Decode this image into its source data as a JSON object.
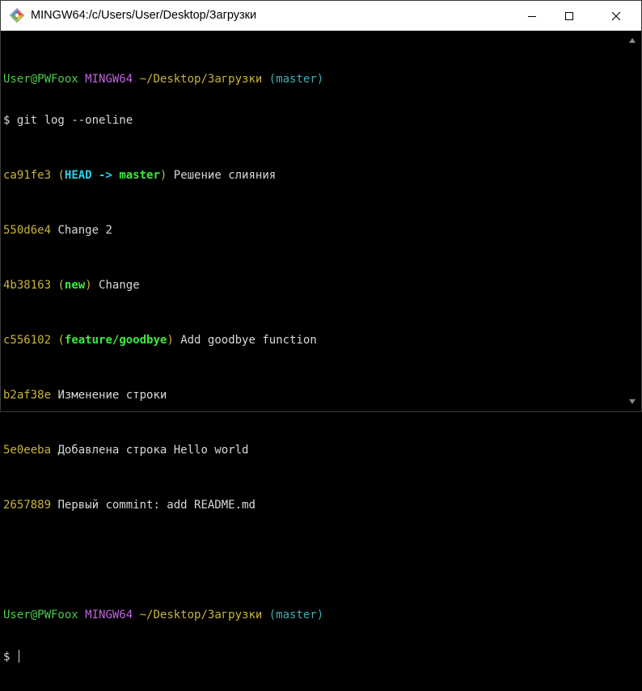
{
  "window": {
    "title": "MINGW64:/c/Users/User/Desktop/Загрузки",
    "app_icon": "git-bash-icon",
    "controls": {
      "minimize": "minimize-icon",
      "maximize": "maximize-icon",
      "close": "close-icon"
    }
  },
  "prompt1": {
    "user_host": "User@PWFoox",
    "space1": " ",
    "system": "MINGW64",
    "space2": " ",
    "path": "~/Desktop/Загрузки",
    "space3": " ",
    "branch": "(master)"
  },
  "command": "$ git log --oneline",
  "log": [
    {
      "hash": "ca91fe3",
      "sp": " ",
      "open": "(",
      "head": "HEAD",
      "arrow": " -> ",
      "ref": "master",
      "close": ")",
      "msg": " Решение слияния"
    },
    {
      "hash": "550d6e4",
      "msg": " Change 2"
    },
    {
      "hash": "4b38163",
      "sp": " ",
      "open": "(",
      "ref": "new",
      "close": ")",
      "msg": " Change"
    },
    {
      "hash": "c556102",
      "sp": " ",
      "open": "(",
      "ref": "feature/goodbye",
      "close": ")",
      "msg": " Add goodbye function"
    },
    {
      "hash": "b2af38e",
      "msg": " Изменение строки"
    },
    {
      "hash": "5e0eeba",
      "msg": " Добавлена строка Hello world"
    },
    {
      "hash": "2657889",
      "msg": " Первый commint: add README.md"
    }
  ],
  "prompt2": {
    "user_host": "User@PWFoox",
    "space1": " ",
    "system": "MINGW64",
    "space2": " ",
    "path": "~/Desktop/Загрузки",
    "space3": " ",
    "branch": "(master)"
  },
  "input_prompt": "$ ",
  "colors": {
    "user": "#4ec94e",
    "system": "#c064e0",
    "path": "#c8b43e",
    "branch": "#3fb0b8",
    "head_ref": "#2fd0e8",
    "local_ref": "#3ee83e",
    "text": "#d8d8d8",
    "background": "#000000"
  }
}
